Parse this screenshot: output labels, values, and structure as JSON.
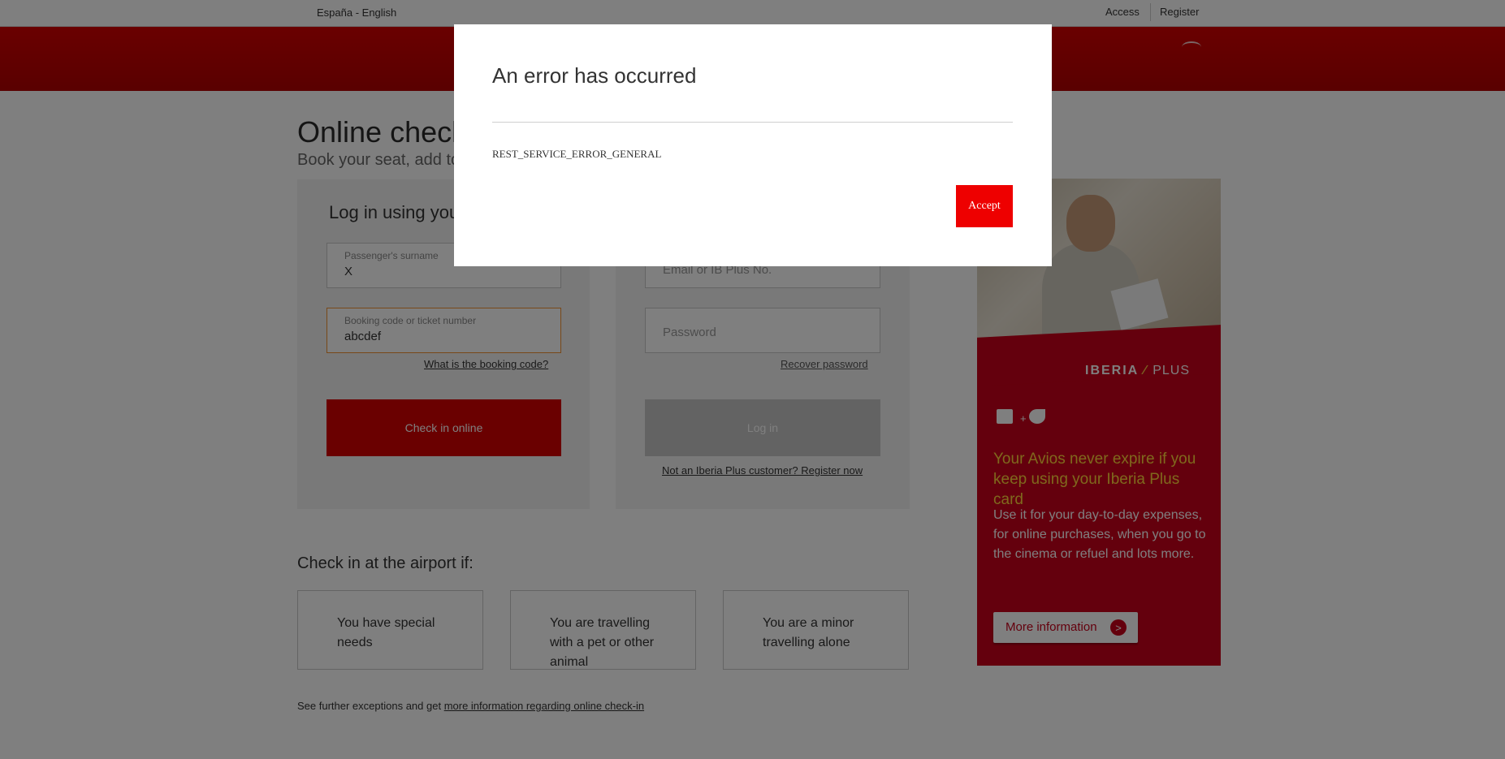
{
  "topbar": {
    "language": "España - English",
    "access": "Access",
    "register": "Register"
  },
  "page": {
    "title": "Online check",
    "subtitle": "Book your seat, add to"
  },
  "booking_login": {
    "heading": "Log in using you",
    "surname_label": "Passenger's surname",
    "surname_value": "X",
    "booking_label": "Booking code or ticket number",
    "booking_value": "abcdef",
    "booking_help_link": "What is the booking code?",
    "check_in_button": "Check in online"
  },
  "iberia_plus_login": {
    "email_placeholder": "Email or IB Plus No.",
    "password_placeholder": "Password",
    "recover_link": "Recover password",
    "login_button": "Log in",
    "register_link": "Not an Iberia Plus customer? Register now"
  },
  "airport": {
    "heading": "Check in at the airport if:",
    "cards": [
      "You have special needs",
      "You are travelling with a pet or other animal",
      "You are a minor travelling alone"
    ],
    "note_prefix": "See further exceptions and get ",
    "note_link": "more information regarding online check-in"
  },
  "banner": {
    "brand": "IBERIA",
    "brand_plus": "PLUS",
    "headline": "Your Avios never expire if you keep using your Iberia Plus card",
    "body": "Use it for your day-to-day expenses, for online purchases, when you go to the cinema or refuel and lots more.",
    "more_button": "More information",
    "more_arrow": ">"
  },
  "modal": {
    "title": "An error has occurred",
    "message": "REST_SERVICE_ERROR_GENERAL",
    "accept_button": "Accept"
  },
  "colors": {
    "brand_red": "#d40000",
    "accept_red": "#ee0000",
    "banner_headline_yellow": "#ffd23a",
    "focus_orange": "#f09030"
  }
}
